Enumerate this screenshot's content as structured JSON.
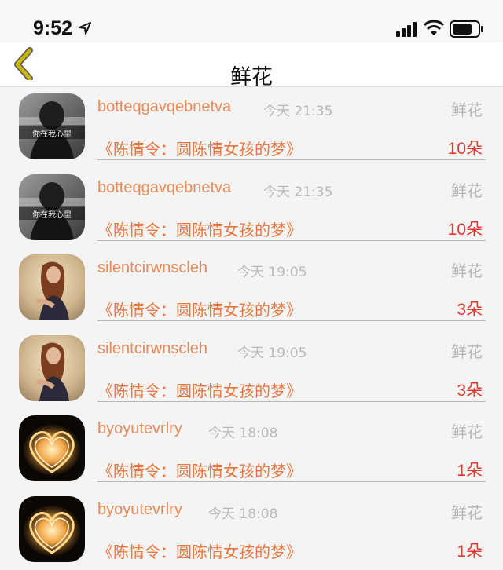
{
  "status_bar": {
    "time": "9:52",
    "icons": [
      "location-arrow-icon",
      "signal-bars-icon",
      "wifi-icon",
      "battery-icon"
    ]
  },
  "nav": {
    "back_icon": "chevron-left-icon",
    "title": "鲜花"
  },
  "colors": {
    "username": "#e88a5a",
    "post_title": "#e8763f",
    "count": "#e03a2f",
    "muted": "#b9b9b9",
    "back_chevron": "#c9b40c"
  },
  "rows": [
    {
      "avatar": "girl-bw-avatar",
      "username": "botteqgavqebnetva",
      "time": "今天 21:35",
      "gift": "鲜花",
      "title": "《陈情令：圆陈情女孩的梦》",
      "count": "10朵"
    },
    {
      "avatar": "girl-bw-avatar",
      "username": "botteqgavqebnetva",
      "time": "今天 21:35",
      "gift": "鲜花",
      "title": "《陈情令：圆陈情女孩的梦》",
      "count": "10朵"
    },
    {
      "avatar": "girl-field-avatar",
      "username": "silentcirwnscleh",
      "time": "今天 19:05",
      "gift": "鲜花",
      "title": "《陈情令：圆陈情女孩的梦》",
      "count": "3朵"
    },
    {
      "avatar": "girl-field-avatar",
      "username": "silentcirwnscleh",
      "time": "今天 19:05",
      "gift": "鲜花",
      "title": "《陈情令：圆陈情女孩的梦》",
      "count": "3朵"
    },
    {
      "avatar": "light-heart-avatar",
      "username": "byoyutevrlry",
      "time": "今天 18:08",
      "gift": "鲜花",
      "title": "《陈情令：圆陈情女孩的梦》",
      "count": "1朵"
    },
    {
      "avatar": "light-heart-avatar",
      "username": "byoyutevrlry",
      "time": "今天 18:08",
      "gift": "鲜花",
      "title": "《陈情令：圆陈情女孩的梦》",
      "count": "1朵"
    }
  ],
  "avatar_captions": {
    "girl_bw": "你在我心里"
  }
}
